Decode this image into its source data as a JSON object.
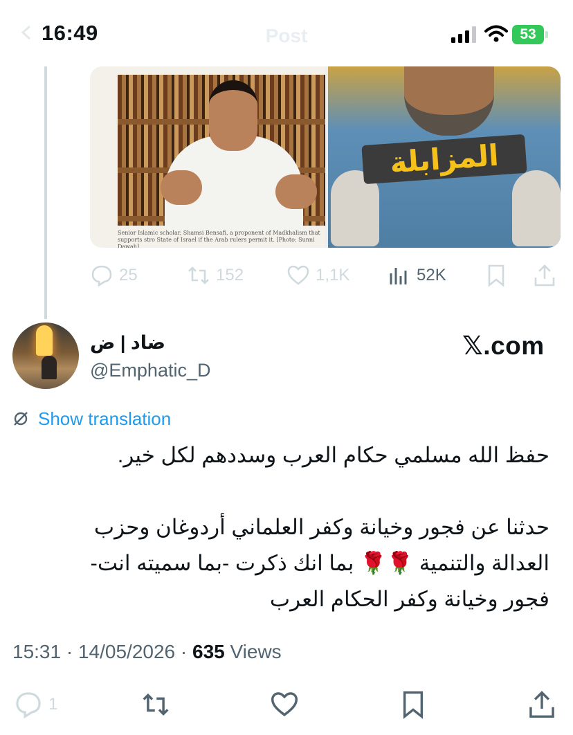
{
  "status_bar": {
    "time": "16:49",
    "battery": "53"
  },
  "nav": {
    "title": "Post"
  },
  "quoted": {
    "caption": "Senior Islamic scholar, Shamsi Bensafi, a proponent of Madkhalism that supports stro State of Israel if the Arab rulers permit it. [Photo: Sunni Dawah]",
    "poster_title": "المزابلة",
    "stats": {
      "replies": "25",
      "reposts": "152",
      "likes": "1,1K",
      "views": "52K"
    }
  },
  "author": {
    "display_name": "ضاد | ض",
    "handle": "@Emphatic_D"
  },
  "watermark": "𝕏.com",
  "translation_label": "Show translation",
  "tweet": {
    "line1": "حفظ الله مسلمي حكام العرب وسددهم لكل خير.",
    "line2": "حدثنا عن فجور وخيانة وكفر العلماني أردوغان وحزب",
    "line3": "العدالة والتنمية 🌹🌹 بما انك ذكرت -بما سميته انت-",
    "line4": "فجور وخيانة وكفر الحكام العرب"
  },
  "meta": {
    "time": "15:31",
    "date": "14/05/2026",
    "views_count": "635",
    "views_label": "Views"
  },
  "bottom_actions": {
    "reply_count": "1"
  },
  "colors": {
    "accent": "#1d9bf0",
    "muted": "#536471",
    "faint": "#cfd9de",
    "battery": "#34c759"
  },
  "icons": [
    "back-chevron-icon",
    "signal-icon",
    "wifi-icon",
    "battery-icon",
    "reply-icon",
    "retweet-icon",
    "like-icon",
    "views-icon",
    "bookmark-icon",
    "share-icon",
    "translate-icon"
  ]
}
